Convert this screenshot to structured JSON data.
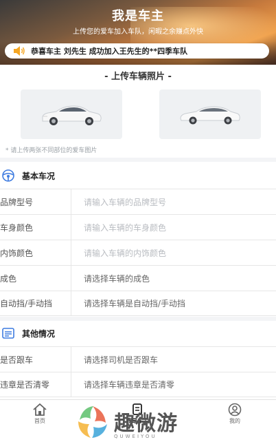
{
  "hero": {
    "title": "我是车主",
    "subtitle": "上传您的爱车加入车队，闲暇之余赚点外快",
    "notice": "恭喜车主 刘先生 成功加入王先生的**四季车队"
  },
  "upload": {
    "title": "- 上传车辆照片 -",
    "hint": "* 请上传两张不同部位的爱车图片"
  },
  "basic": {
    "title": "基本车况",
    "rows": [
      {
        "label": "品牌型号",
        "value": "请输入车辆的品牌型号",
        "kind": "input"
      },
      {
        "label": "车身颜色",
        "value": "请输入车辆的车身颜色",
        "kind": "input"
      },
      {
        "label": "内饰颜色",
        "value": "请输入车辆的内饰颜色",
        "kind": "input"
      },
      {
        "label": "成色",
        "value": "请选择车辆的成色",
        "kind": "select"
      },
      {
        "label": "自动挡/手动挡",
        "value": "请选择车辆是自动挡/手动挡",
        "kind": "select"
      }
    ]
  },
  "other": {
    "title": "其他情况",
    "rows": [
      {
        "label": "是否跟车",
        "value": "请选择司机是否跟车",
        "kind": "select"
      },
      {
        "label": "违章是否清零",
        "value": "请选择车辆违章是否清零",
        "kind": "select"
      }
    ]
  },
  "tabbar": {
    "items": [
      {
        "label": "首页",
        "icon": "home-icon"
      },
      {
        "label": "我是车主",
        "icon": "car-owner-icon"
      },
      {
        "label": "我的",
        "icon": "profile-icon"
      }
    ]
  },
  "watermark": {
    "text": "趣微游",
    "sub": "QUWEIYOU"
  },
  "colors": {
    "accent": "#3d7be0",
    "placeholder": "#b9bcc1",
    "banner": "#c77a3d"
  }
}
